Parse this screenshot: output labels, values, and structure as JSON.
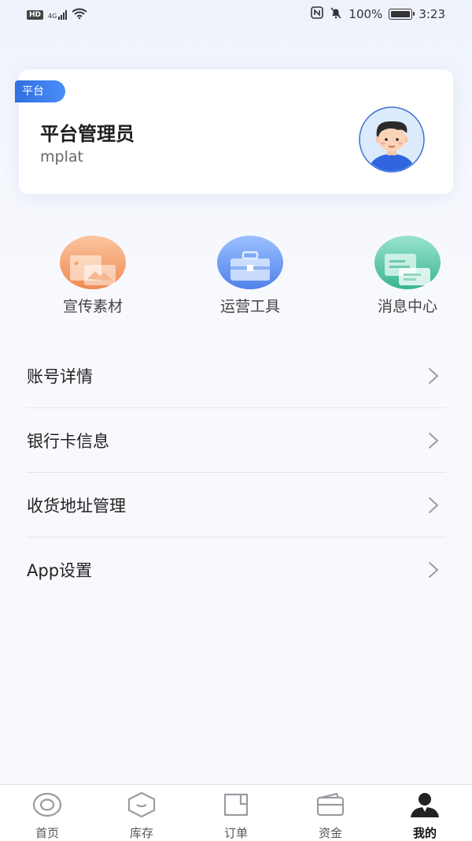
{
  "status_bar": {
    "network_badge": "HD",
    "network_type": "4G",
    "battery": "100%",
    "time": "3:23"
  },
  "profile": {
    "role_tag": "平台",
    "name": "平台管理员",
    "username": "mplat"
  },
  "quick_actions": [
    {
      "label": "宣传素材",
      "icon": "image-stack-icon",
      "color": "#f3905c"
    },
    {
      "label": "运营工具",
      "icon": "toolbox-icon",
      "color": "#5b8ef0"
    },
    {
      "label": "消息中心",
      "icon": "message-bubbles-icon",
      "color": "#3fb89a"
    }
  ],
  "menu": [
    {
      "label": "账号详情"
    },
    {
      "label": "银行卡信息"
    },
    {
      "label": "收货地址管理"
    },
    {
      "label": "App设置"
    }
  ],
  "tabs": [
    {
      "label": "首页",
      "icon": "home-target-icon",
      "active": false
    },
    {
      "label": "库存",
      "icon": "box-icon",
      "active": false
    },
    {
      "label": "订单",
      "icon": "order-doc-icon",
      "active": false
    },
    {
      "label": "资金",
      "icon": "wallet-icon",
      "active": false
    },
    {
      "label": "我的",
      "icon": "user-icon",
      "active": true
    }
  ],
  "colors": {
    "accent": "#3a7ae8",
    "tab_active": "#222222",
    "tab_inactive": "#9a9ca3"
  }
}
